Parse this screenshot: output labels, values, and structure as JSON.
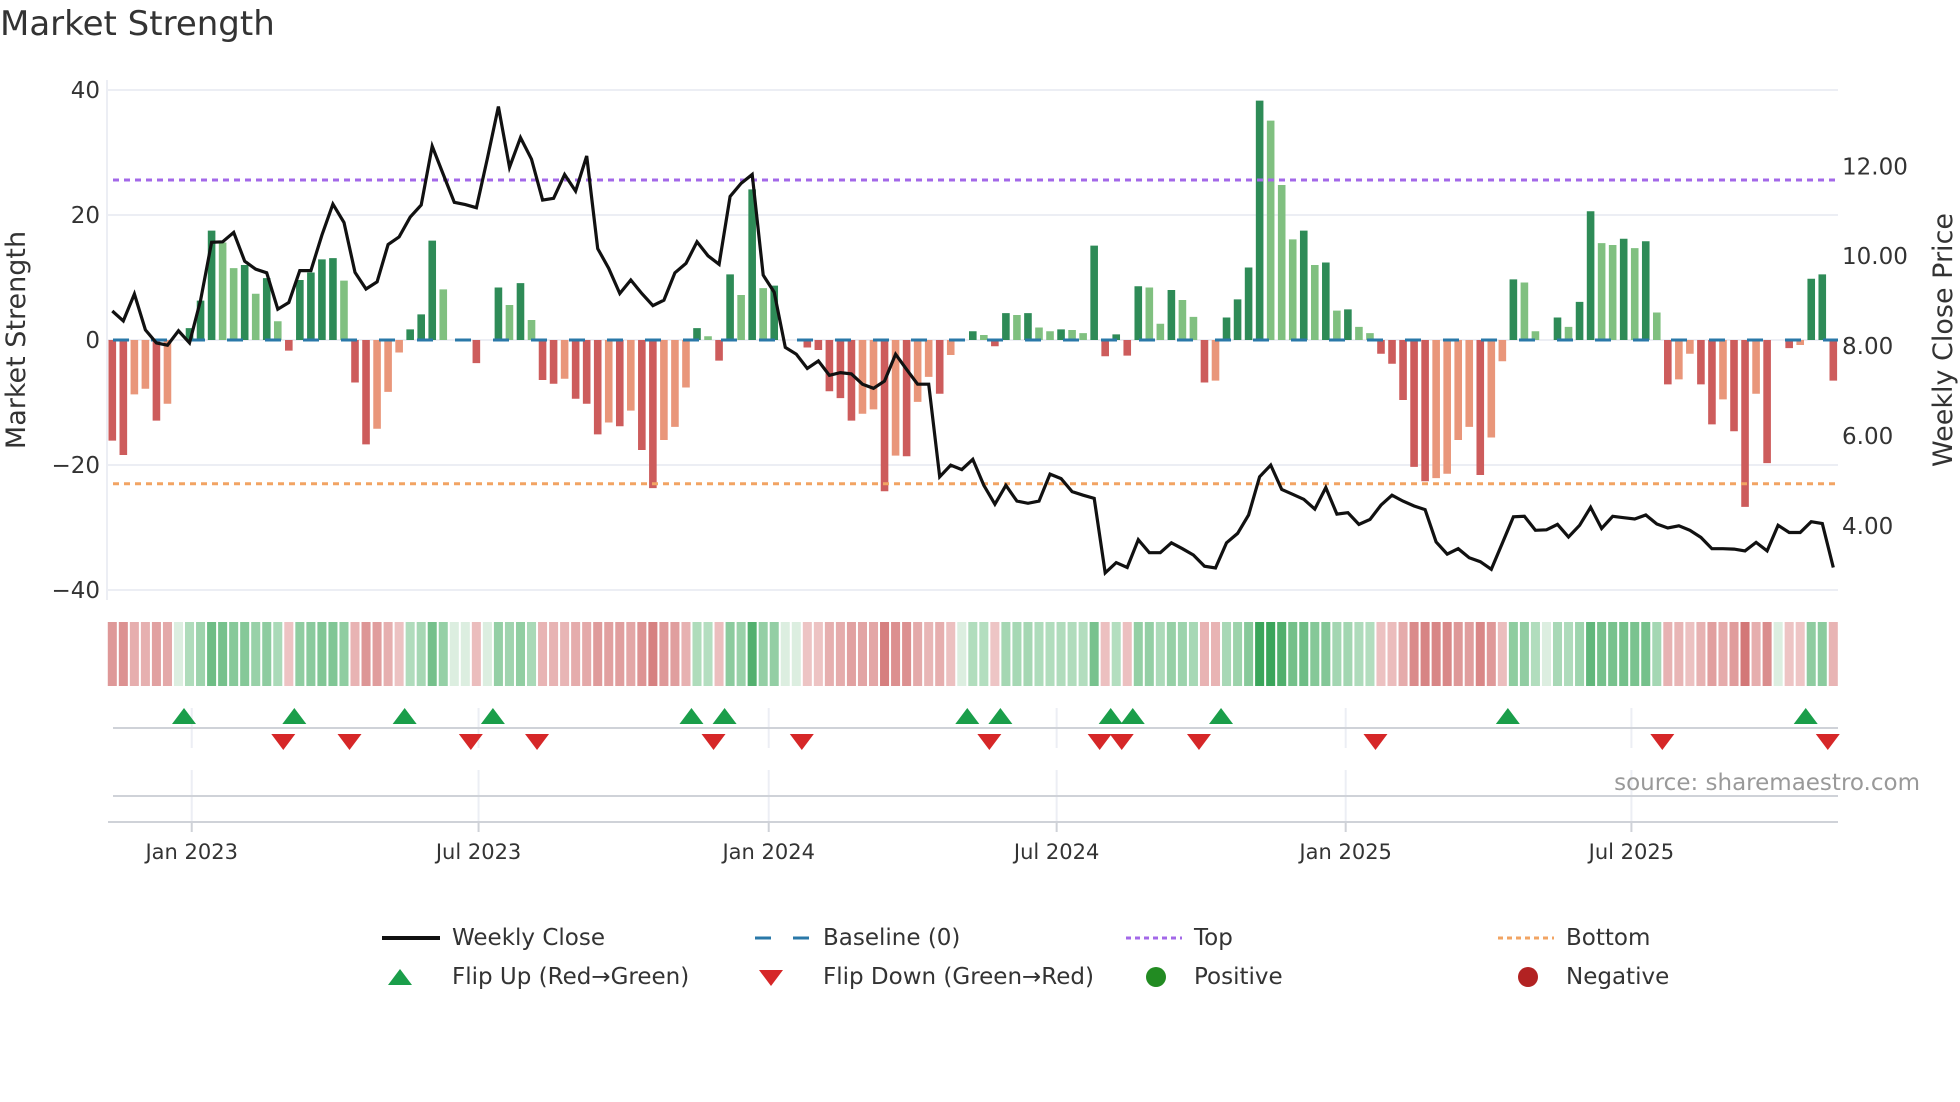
{
  "title": "Market Strength",
  "source": "source: sharemaestro.com",
  "colors": {
    "price": "#111111",
    "baseline": "#2a78a8",
    "top": "#a368e8",
    "bottom": "#f2a463",
    "pos_dark": "#2e8b57",
    "pos_light": "#80c080",
    "neg_dark": "#cd5c5c",
    "neg_light": "#e9967a",
    "flip_up": "#1a9e4a",
    "flip_down": "#d62728",
    "positive": "#228b22",
    "negative": "#b22222"
  },
  "legend": [
    {
      "key": "weekly_close",
      "label": "Weekly Close"
    },
    {
      "key": "baseline",
      "label": "Baseline (0)"
    },
    {
      "key": "top",
      "label": "Top"
    },
    {
      "key": "bottom",
      "label": "Bottom"
    },
    {
      "key": "flip_up",
      "label": "Flip Up (Red→Green)"
    },
    {
      "key": "flip_down",
      "label": "Flip Down (Green→Red)"
    },
    {
      "key": "positive",
      "label": "Positive"
    },
    {
      "key": "negative",
      "label": "Negative"
    }
  ],
  "chart_data": {
    "type": "bar+line",
    "title": "Market Strength",
    "ylabel": "Market Strength",
    "y2label": "Weekly Close Price",
    "ylim": [
      -40,
      40
    ],
    "y2lim": [
      2.57,
      13.7
    ],
    "yticks": [
      {
        "v": 40,
        "label": "40"
      },
      {
        "v": 20,
        "label": "20"
      },
      {
        "v": 0,
        "label": "0"
      },
      {
        "v": -20,
        "label": "−20"
      },
      {
        "v": -40,
        "label": "−40"
      }
    ],
    "y2ticks": [
      {
        "v": 12,
        "label": "12.00"
      },
      {
        "v": 10,
        "label": "10.00"
      },
      {
        "v": 8,
        "label": "8.00"
      },
      {
        "v": 6,
        "label": "6.00"
      },
      {
        "v": 4,
        "label": "4.00"
      }
    ],
    "xticks": [
      {
        "week": 7.2,
        "label": "Jan 2023"
      },
      {
        "week": 33.2,
        "label": "Jul 2023"
      },
      {
        "week": 59.5,
        "label": "Jan 2024"
      },
      {
        "week": 85.6,
        "label": "Jul 2024"
      },
      {
        "week": 111.8,
        "label": "Jan 2025"
      },
      {
        "week": 137.7,
        "label": "Jul 2025"
      }
    ],
    "top_level": 25.6,
    "bottom_level": -23.0,
    "baseline": 0,
    "strength": [
      -16.1,
      -18.4,
      -8.7,
      -7.8,
      -12.9,
      -10.2,
      0,
      1.9,
      6.3,
      17.5,
      15.6,
      11.5,
      12.0,
      7.4,
      9.9,
      3.0,
      -1.7,
      9.6,
      10.8,
      12.9,
      13.1,
      9.5,
      -6.8,
      -16.7,
      -14.2,
      -8.3,
      -2.0,
      1.7,
      4.1,
      15.9,
      8.1,
      0,
      0,
      -3.7,
      0,
      8.4,
      5.6,
      9.1,
      3.2,
      -6.4,
      -7.0,
      -6.2,
      -9.4,
      -10.2,
      -15.1,
      -13.2,
      -13.8,
      -11.3,
      -17.6,
      -23.7,
      -16.0,
      -13.9,
      -7.6,
      1.9,
      0.6,
      -3.3,
      10.5,
      7.2,
      24.1,
      8.3,
      8.7,
      0,
      0,
      -1.2,
      -1.6,
      -8.2,
      -9.3,
      -12.9,
      -11.8,
      -11.1,
      -24.2,
      -18.5,
      -18.6,
      -9.9,
      -5.9,
      -8.6,
      -2.4,
      0,
      1.4,
      0.8,
      -1.0,
      4.3,
      4.0,
      4.3,
      2.0,
      1.4,
      1.7,
      1.6,
      1.1,
      15.1,
      -2.6,
      0.9,
      -2.5,
      8.6,
      8.4,
      2.6,
      8.0,
      6.4,
      3.7,
      -6.8,
      -6.5,
      3.6,
      6.5,
      11.6,
      38.3,
      35.1,
      24.8,
      16.1,
      17.5,
      12.0,
      12.4,
      4.7,
      4.9,
      2.1,
      1.1,
      -2.2,
      -3.8,
      -9.6,
      -20.3,
      -22.6,
      -22.1,
      -21.4,
      -16.0,
      -13.9,
      -21.6,
      -15.6,
      -3.4,
      9.7,
      9.2,
      1.4,
      0,
      3.6,
      2.1,
      6.1,
      20.6,
      15.5,
      15.2,
      16.2,
      14.7,
      15.8,
      4.4,
      -7.1,
      -6.3,
      -2.2,
      -7.1,
      -13.5,
      -9.5,
      -14.6,
      -26.7,
      -8.6,
      -19.7,
      0,
      -1.3,
      -0.8,
      9.8,
      10.5,
      -6.5
    ],
    "weekly_close": [
      8.78,
      8.56,
      9.16,
      8.36,
      8.07,
      8.02,
      8.34,
      8.07,
      9.02,
      10.31,
      10.32,
      10.53,
      9.89,
      9.71,
      9.63,
      8.82,
      8.97,
      9.68,
      9.68,
      10.47,
      11.16,
      10.75,
      9.64,
      9.27,
      9.43,
      10.26,
      10.43,
      10.87,
      11.14,
      12.45,
      11.82,
      11.2,
      11.15,
      11.08,
      12.18,
      13.33,
      11.98,
      12.64,
      12.16,
      11.25,
      11.29,
      11.82,
      11.45,
      12.23,
      10.17,
      9.73,
      9.17,
      9.47,
      9.17,
      8.9,
      9.02,
      9.63,
      9.84,
      10.32,
      10.01,
      9.82,
      11.33,
      11.62,
      11.82,
      9.58,
      9.2,
      7.97,
      7.82,
      7.5,
      7.67,
      7.35,
      7.41,
      7.38,
      7.15,
      7.06,
      7.22,
      7.82,
      7.48,
      7.15,
      7.15,
      5.09,
      5.35,
      5.25,
      5.48,
      4.9,
      4.48,
      4.9,
      4.55,
      4.5,
      4.55,
      5.15,
      5.05,
      4.76,
      4.68,
      4.61,
      2.95,
      3.18,
      3.07,
      3.69,
      3.4,
      3.4,
      3.62,
      3.49,
      3.35,
      3.1,
      3.06,
      3.62,
      3.83,
      4.24,
      5.09,
      5.35,
      4.81,
      4.7,
      4.59,
      4.37,
      4.85,
      4.26,
      4.29,
      4.03,
      4.14,
      4.46,
      4.68,
      4.55,
      4.44,
      4.36,
      3.64,
      3.37,
      3.49,
      3.29,
      3.2,
      3.03,
      3.61,
      4.2,
      4.21,
      3.9,
      3.91,
      4.03,
      3.75,
      4.01,
      4.41,
      3.94,
      4.21,
      4.18,
      4.15,
      4.24,
      4.04,
      3.95,
      4.0,
      3.9,
      3.74,
      3.49,
      3.49,
      3.48,
      3.44,
      3.63,
      3.44,
      4.01,
      3.85,
      3.85,
      4.09,
      4.05,
      3.07
    ],
    "grid": true,
    "legend_position": "bottom"
  }
}
